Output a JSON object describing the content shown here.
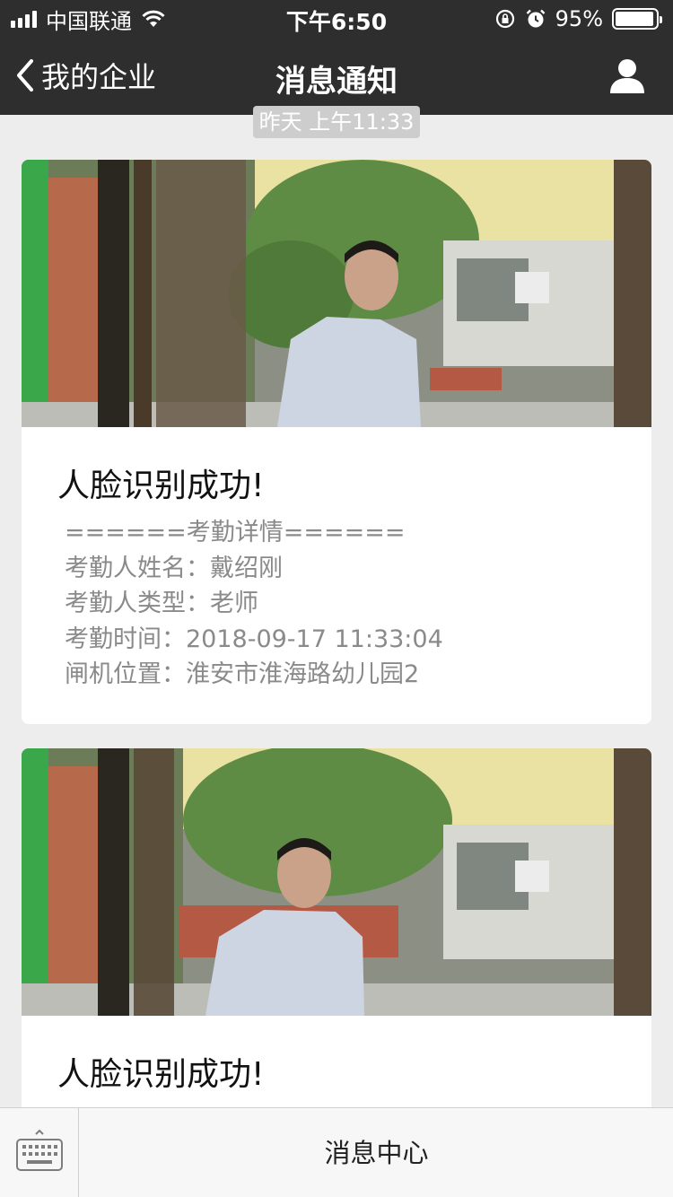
{
  "status_bar": {
    "carrier": "中国联通",
    "time": "下午6:50",
    "battery_percent": "95%",
    "battery_level": 0.95,
    "signal_bars": 4,
    "icons": [
      "signal-icon",
      "wifi-icon",
      "rotation-lock-icon",
      "alarm-icon",
      "battery-icon"
    ]
  },
  "nav": {
    "back_label": "我的企业",
    "title": "消息通知",
    "icons": [
      "chevron-left-icon",
      "user-icon"
    ]
  },
  "timestamp": "昨天 上午11:33",
  "messages": [
    {
      "photo": "camera-snapshot-man-entering-gate",
      "title": "人脸识别成功!",
      "lines": [
        "======考勤详情======",
        "考勤人姓名：戴绍刚",
        "考勤人类型：老师",
        "考勤时间：2018-09-17 11:33:04",
        "闸机位置：淮安市淮海路幼儿园2"
      ]
    },
    {
      "photo": "camera-snapshot-man-entering-gate",
      "title": "人脸识别成功!"
    }
  ],
  "bottom_bar": {
    "menu_label": "消息中心",
    "icons": [
      "keyboard-icon"
    ]
  },
  "colors": {
    "nav_bg": "#2e2e2f",
    "page_bg": "#ededed",
    "card_bg": "#ffffff",
    "detail_text": "#8a8a8a"
  }
}
